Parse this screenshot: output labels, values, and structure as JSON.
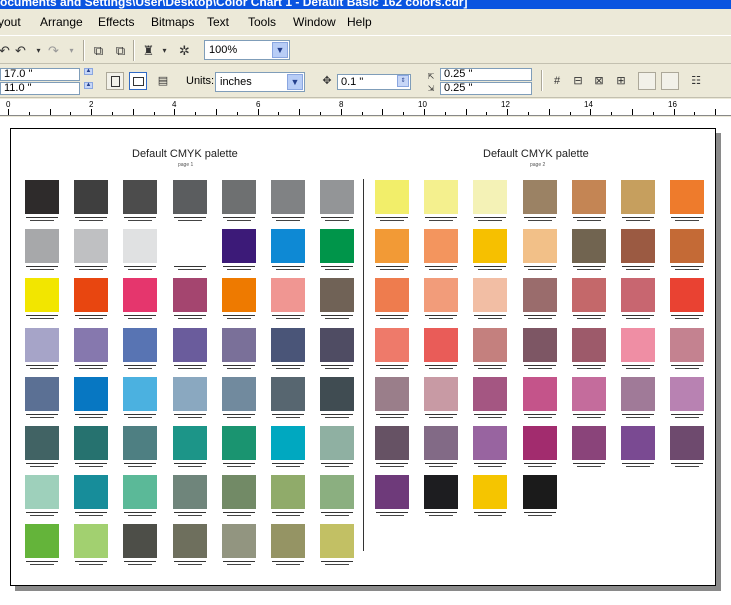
{
  "window": {
    "title": "ocuments and Settings\\User\\Desktop\\Color Chart 1 - Default Basic 162 colors.cdr]"
  },
  "menu": [
    "yout",
    "Arrange",
    "Effects",
    "Bitmaps",
    "Text",
    "Tools",
    "Window",
    "Help"
  ],
  "toolbar": {
    "zoom": "100%"
  },
  "property_bar": {
    "width": "17.0 \"",
    "height": "11.0 \"",
    "units_label": "Units:",
    "units_value": "inches",
    "nudge": "0.1 \"",
    "dup_x": "0.25 \"",
    "dup_y": "0.25 \""
  },
  "ruler": {
    "labels": [
      "0",
      "2",
      "4",
      "6",
      "8",
      "10",
      "12",
      "14",
      "16"
    ]
  },
  "document": {
    "page1": {
      "title": "Default CMYK palette",
      "subtitle": "page 1",
      "colors": [
        "#2e2b2b",
        "#3f3f3f",
        "#4c4c4c",
        "#5b5d5f",
        "#6e7071",
        "#808284",
        "#939597",
        "#a7a8aa",
        "#bfc0c2",
        "#e0e1e2",
        "#ffffff",
        "#3c1a78",
        "#0e89d4",
        "#00954a",
        "#f2e600",
        "#e84610",
        "#e5366d",
        "#a4456f",
        "#ee7a00",
        "#f09692",
        "#706256",
        "#a6a4c8",
        "#8678ae",
        "#5874b3",
        "#6a5c9c",
        "#7a7099",
        "#4a5578",
        "#4f4c63",
        "#5b7094",
        "#0777c2",
        "#4bb1e0",
        "#8aa8c0",
        "#718a9e",
        "#576670",
        "#404c52",
        "#416364",
        "#26726f",
        "#4e7f82",
        "#1c9588",
        "#1a9470",
        "#00a8c0",
        "#8fb0a2",
        "#9ed0bb",
        "#178d9a",
        "#5bb998",
        "#6f857b",
        "#728a66",
        "#90ab6a",
        "#8baf80",
        "#64b43a",
        "#a2d070",
        "#4d4e48",
        "#6e6f5d",
        "#929580",
        "#959464",
        "#c2c064"
      ]
    },
    "page2": {
      "title": "Default CMYK palette",
      "subtitle": "page 2",
      "colors": [
        "#f2ee6a",
        "#f4f08e",
        "#f4f2b6",
        "#9b8264",
        "#c48554",
        "#c69f5e",
        "#ee7b2c",
        "#f29a36",
        "#f3955e",
        "#f6c000",
        "#f2c088",
        "#716450",
        "#9b5a42",
        "#c46a36",
        "#ee7c4e",
        "#f29c7a",
        "#f2bea4",
        "#9a6c6c",
        "#c4686a",
        "#c86670",
        "#e94232",
        "#ee7a6a",
        "#e95c58",
        "#c4807e",
        "#7d5664",
        "#9d5a6a",
        "#ef8ea4",
        "#c48290",
        "#9a7e8a",
        "#c89aa4",
        "#a45682",
        "#c4548a",
        "#c46c9c",
        "#a07a98",
        "#b882b2",
        "#665264",
        "#826a86",
        "#9864a0",
        "#a22c6e",
        "#8a447a",
        "#7a4a92",
        "#6e4a6e",
        "#6e3a7a",
        "#1d1d20",
        "#f5c500",
        "#1b1b1b"
      ]
    }
  }
}
